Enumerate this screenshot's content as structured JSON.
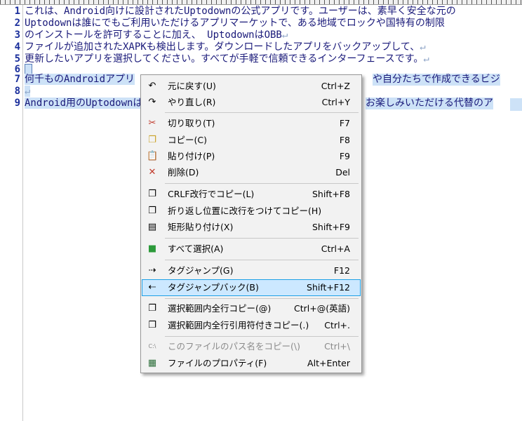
{
  "editor": {
    "lines": [
      {
        "num": "1",
        "text": "これは、Android向けに設計されたUptodownの公式アプリです。ユーザーは、素早く安全な元の"
      },
      {
        "num": "2",
        "text": "Uptodownは誰にでもご利用いただけるアプリマーケットで、ある地域でロックや国特有の制限"
      },
      {
        "num": "3",
        "text": "のインストールを許可することに加え、 UptodownはOBB"
      },
      {
        "num": "4",
        "text": "ファイルが追加されたXAPKも検出します。ダウンロードしたアプリをバックアップして、"
      },
      {
        "num": "5",
        "text": "更新したいアプリを選択してください。すべてが手軽で信頼できるインターフェースです。"
      },
      {
        "num": "6",
        "text": ""
      },
      {
        "num": "7",
        "text": "何千ものAndroidアプリ"
      },
      {
        "num": "8",
        "text": ""
      },
      {
        "num": "9",
        "text": "Android用のUptodownは"
      }
    ],
    "line7_tail": "や自分たちで作成できるビジ",
    "line9_tail": "お楽しみいただける代替のア",
    "eol_mark": "↵"
  },
  "context_menu": {
    "items": [
      {
        "label": "元に戻す(U)",
        "shortcut": "Ctrl+Z",
        "icon": "undo-icon",
        "glyph": "↶"
      },
      {
        "label": "やり直し(R)",
        "shortcut": "Ctrl+Y",
        "icon": "redo-icon",
        "glyph": "↷"
      },
      {
        "label": "切り取り(T)",
        "shortcut": "F7",
        "icon": "cut-icon",
        "glyph": "✂"
      },
      {
        "label": "コピー(C)",
        "shortcut": "F8",
        "icon": "copy-icon",
        "glyph": "❐"
      },
      {
        "label": "貼り付け(P)",
        "shortcut": "F9",
        "icon": "paste-icon",
        "glyph": "📋"
      },
      {
        "label": "削除(D)",
        "shortcut": "Del",
        "icon": "delete-icon",
        "glyph": "✕"
      },
      {
        "label": "CRLF改行でコピー(L)",
        "shortcut": "Shift+F8",
        "icon": "copy-crlf-icon",
        "glyph": "❐"
      },
      {
        "label": "折り返し位置に改行をつけてコピー(H)",
        "shortcut": "",
        "icon": "copy-wrap-icon",
        "glyph": "❐"
      },
      {
        "label": "矩形貼り付け(X)",
        "shortcut": "Shift+F9",
        "icon": "box-paste-icon",
        "glyph": "▤"
      },
      {
        "label": "すべて選択(A)",
        "shortcut": "Ctrl+A",
        "icon": "select-all-icon",
        "glyph": "■"
      },
      {
        "label": "タグジャンプ(G)",
        "shortcut": "F12",
        "icon": "tag-jump-icon",
        "glyph": "⇢"
      },
      {
        "label": "タグジャンプバック(B)",
        "shortcut": "Shift+F12",
        "icon": "tag-jump-back-icon",
        "glyph": "⇠"
      },
      {
        "label": "選択範囲内全行コピー(@)",
        "shortcut": "Ctrl+@(英語)",
        "icon": "copy-lines-icon",
        "glyph": "❐"
      },
      {
        "label": "選択範囲内全行引用符付きコピー(.)",
        "shortcut": "Ctrl+.",
        "icon": "copy-quoted-icon",
        "glyph": "❐"
      },
      {
        "label": "このファイルのパス名をコピー(\\)",
        "shortcut": "Ctrl+\\",
        "icon": "copy-path-icon",
        "glyph": "C:\\"
      },
      {
        "label": "ファイルのプロパティ(F)",
        "shortcut": "Alt+Enter",
        "icon": "file-properties-icon",
        "glyph": "▦"
      }
    ]
  },
  "colors": {
    "line_number": "#1b2f9c",
    "text": "#1a1a7a",
    "selection": "#cde2f7",
    "menu_highlight": "#cce8ff",
    "menu_highlight_border": "#1ea0e6",
    "disabled_text": "#8a8a8a"
  }
}
